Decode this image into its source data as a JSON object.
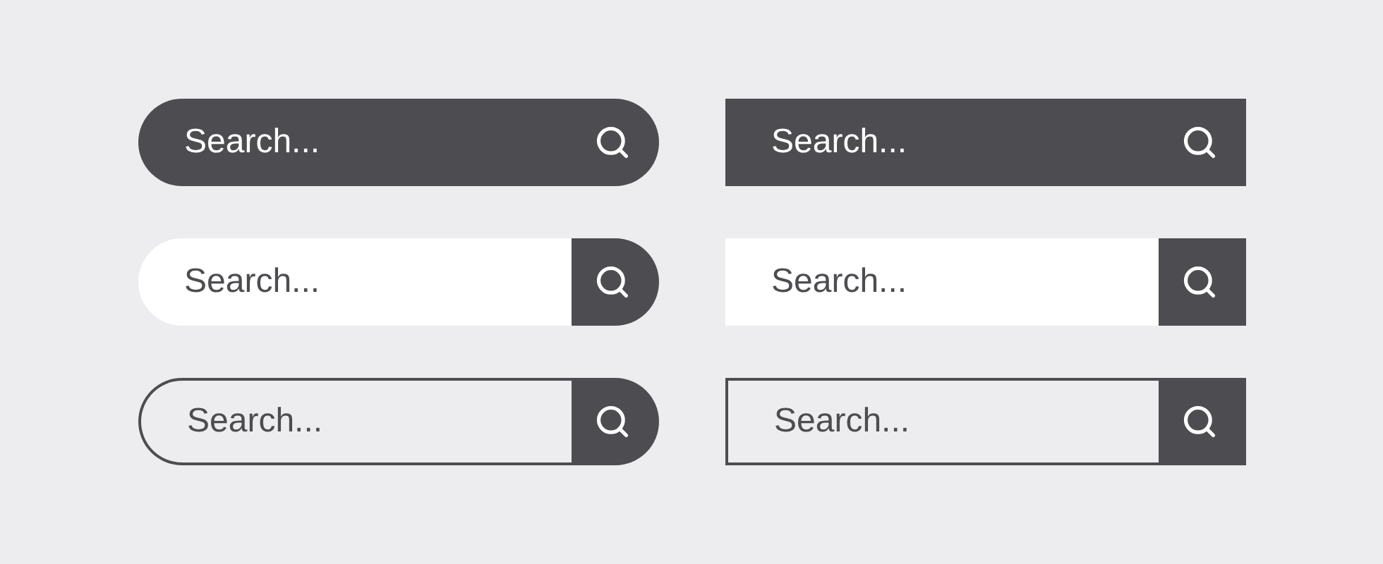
{
  "search_bars": [
    {
      "kind": "filled",
      "rounded": true,
      "placeholder": "Search..."
    },
    {
      "kind": "filled",
      "rounded": false,
      "placeholder": "Search..."
    },
    {
      "kind": "button",
      "rounded": true,
      "placeholder": "Search..."
    },
    {
      "kind": "button",
      "rounded": false,
      "placeholder": "Search..."
    },
    {
      "kind": "outlined",
      "rounded": true,
      "placeholder": "Search..."
    },
    {
      "kind": "outlined",
      "rounded": false,
      "placeholder": "Search..."
    }
  ]
}
